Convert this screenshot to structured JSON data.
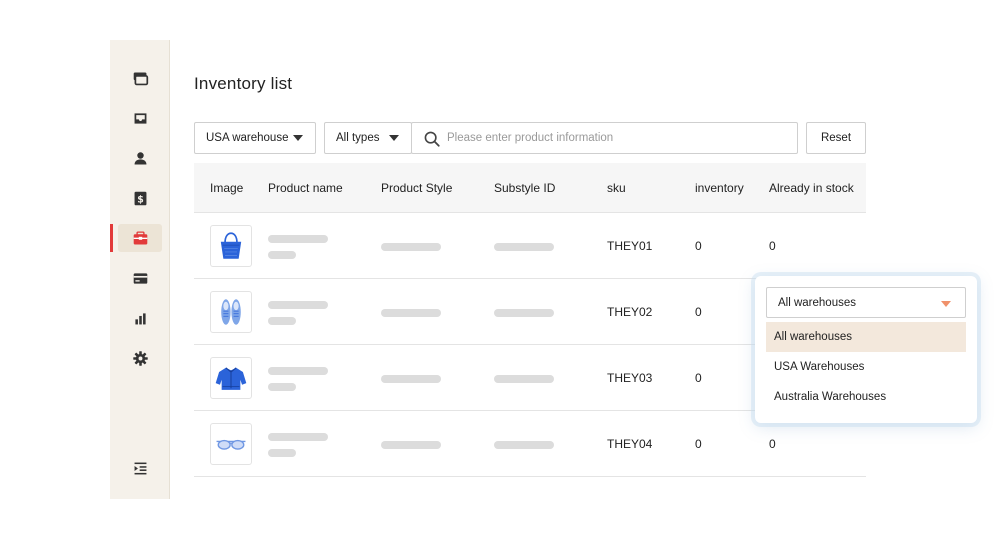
{
  "page": {
    "title": "Inventory list"
  },
  "sidebar": {
    "items": [
      {
        "icon": "layers-icon"
      },
      {
        "icon": "inbox-icon"
      },
      {
        "icon": "user-icon"
      },
      {
        "icon": "dollar-icon"
      },
      {
        "icon": "store-icon",
        "active": true
      },
      {
        "icon": "credit-card-icon"
      },
      {
        "icon": "bar-chart-icon"
      },
      {
        "icon": "gear-icon"
      }
    ],
    "footer_icon": "indent-menu-icon",
    "accent": "#e23a3a"
  },
  "filters": {
    "warehouse": "USA warehouse",
    "type": "All types",
    "search_placeholder": "Please enter product information",
    "reset_label": "Reset"
  },
  "table": {
    "columns": [
      "Image",
      "Product name",
      "Product Style",
      "Substyle ID",
      "sku",
      "inventory",
      "Already in stock"
    ],
    "rows": [
      {
        "image_icon": "handbag-icon",
        "sku": "THEY01",
        "inventory": "0",
        "in_stock": "0"
      },
      {
        "image_icon": "sneakers-icon",
        "sku": "THEY02",
        "inventory": "0",
        "in_stock": ""
      },
      {
        "image_icon": "jacket-icon",
        "sku": "THEY03",
        "inventory": "0",
        "in_stock": ""
      },
      {
        "image_icon": "glasses-icon",
        "sku": "THEY04",
        "inventory": "0",
        "in_stock": "0"
      }
    ]
  },
  "dropdown": {
    "selected": "All warehouses",
    "options": [
      "All warehouses",
      "USA Warehouses",
      "Australia Warehouses"
    ]
  },
  "colors": {
    "product_blue": "#2b63d9",
    "selected_option_bg": "#f3e8dc",
    "caret_accent": "#f0916b"
  }
}
